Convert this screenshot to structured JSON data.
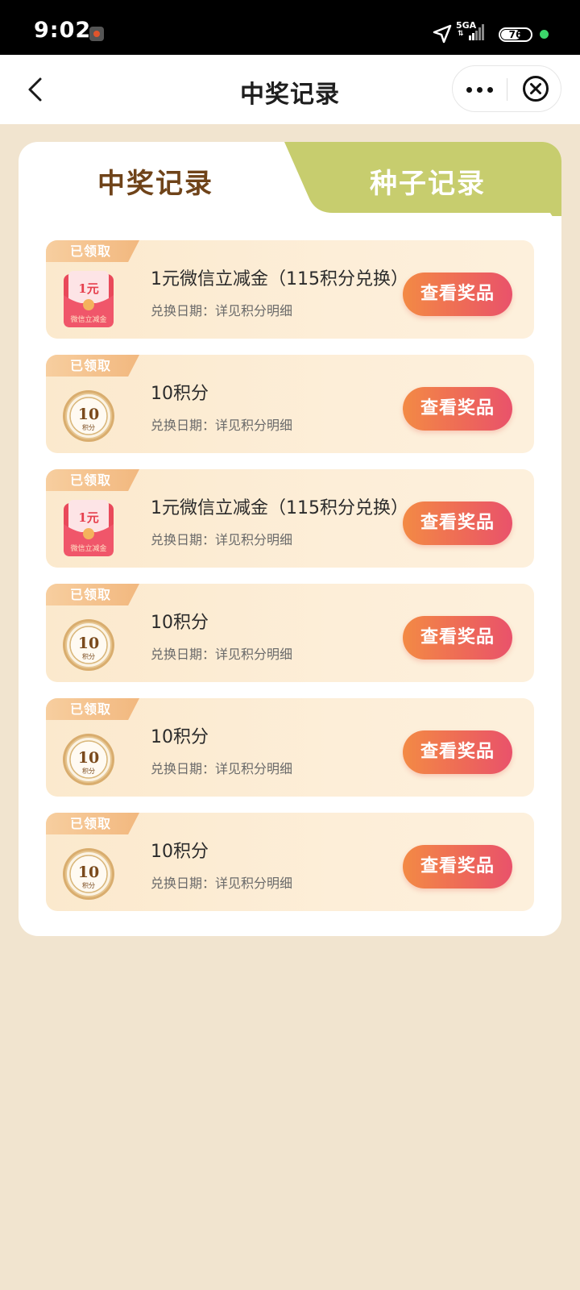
{
  "status_bar": {
    "time": "9:02",
    "network": "5GA",
    "network_arrows": "⇅",
    "battery": "76"
  },
  "nav": {
    "title": "中奖记录"
  },
  "tabs": {
    "active": "中奖记录",
    "inactive": "种子记录"
  },
  "records": [
    {
      "status": "已领取",
      "type": "red-envelope",
      "icon_amount": "1元",
      "icon_caption": "微信立减金",
      "name": "1元微信立减金（115积分兑换）",
      "date": "兑换日期：详见积分明细",
      "button": "查看奖品"
    },
    {
      "status": "已领取",
      "type": "coin",
      "icon_amount": "10",
      "icon_caption": "积分",
      "name": "10积分",
      "date": "兑换日期：详见积分明细",
      "button": "查看奖品"
    },
    {
      "status": "已领取",
      "type": "red-envelope",
      "icon_amount": "1元",
      "icon_caption": "微信立减金",
      "name": "1元微信立减金（115积分兑换）",
      "date": "兑换日期：详见积分明细",
      "button": "查看奖品"
    },
    {
      "status": "已领取",
      "type": "coin",
      "icon_amount": "10",
      "icon_caption": "积分",
      "name": "10积分",
      "date": "兑换日期：详见积分明细",
      "button": "查看奖品"
    },
    {
      "status": "已领取",
      "type": "coin",
      "icon_amount": "10",
      "icon_caption": "积分",
      "name": "10积分",
      "date": "兑换日期：详见积分明细",
      "button": "查看奖品"
    },
    {
      "status": "已领取",
      "type": "coin",
      "icon_amount": "10",
      "icon_caption": "积分",
      "name": "10积分",
      "date": "兑换日期：详见积分明细",
      "button": "查看奖品"
    }
  ],
  "colors": {
    "page_bg": "#f1e4cf",
    "tab_inactive_bg": "#c7cd6e",
    "tab_active_text": "#6f4319",
    "button_gradient_start": "#f38a45",
    "button_gradient_end": "#e9526b"
  }
}
